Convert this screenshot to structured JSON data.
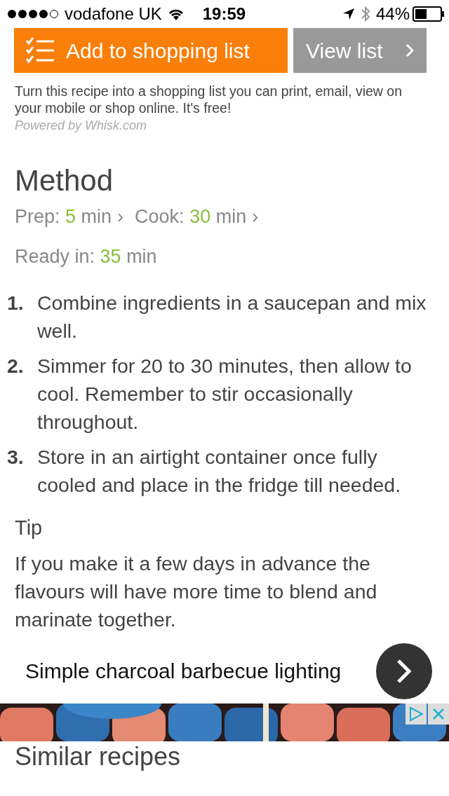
{
  "status_bar": {
    "carrier": "vodafone UK",
    "time": "19:59",
    "battery": "44%"
  },
  "shopping": {
    "add_button": "Add to shopping list",
    "view_button": "View list",
    "description": "Turn this recipe into a shopping list you can print, email, view on your mobile or shop online. It's free!",
    "powered_by": "Powered by Whisk.com"
  },
  "method": {
    "title": "Method",
    "timing_lines": [
      [
        {
          "label": "Prep:",
          "value": "5",
          "unit": "min",
          "separator": "›"
        },
        {
          "label": "Cook:",
          "value": "30",
          "unit": "min",
          "separator": "›"
        }
      ],
      [
        {
          "label": "Ready in:",
          "value": "35",
          "unit": "min"
        }
      ]
    ],
    "steps": [
      {
        "number": "1.",
        "text": "Combine ingredients in a saucepan and mix well."
      },
      {
        "number": "2.",
        "text": "Simmer for 20 to 30 minutes, then allow to cool. Remember to stir occasionally throughout."
      },
      {
        "number": "3.",
        "text": "Store in an airtight container once fully cooled and place in the fridge till needed."
      }
    ]
  },
  "tip": {
    "title": "Tip",
    "text": "If you make it a few days in advance the flavours will have more time to blend and marinate together."
  },
  "related_card": {
    "title": "Simple charcoal barbecue lighting"
  },
  "similar_title": "Similar recipes"
}
